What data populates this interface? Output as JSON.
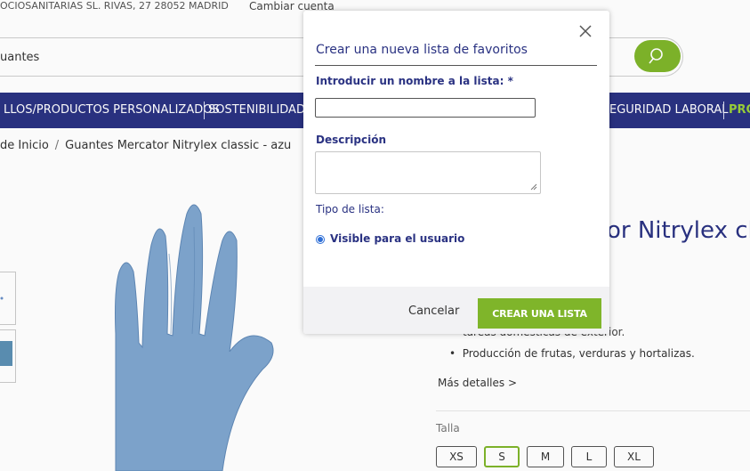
{
  "topbar": {
    "address": "OCIOSANITARIAS SL. RIVAS, 27 28052 MADRID",
    "account": "Cambiar cuenta"
  },
  "search": {
    "value": "uantes",
    "button_icon": "search-icon"
  },
  "nav": {
    "items": [
      "LLOS/PRODUCTOS PERSONALIZADOS",
      "SOSTENIBILIDAD",
      "EGURIDAD LABORAL",
      "PRO"
    ]
  },
  "breadcrumb": {
    "home": "de Inicio",
    "separator": "/",
    "current": "Guantes Mercator Nitrylex classic - azu"
  },
  "product": {
    "title": "or Nitrylex cla",
    "bullet_partial": "tareas domésticas de exterior.",
    "bullet": "Producción de frutas, verduras y hortalizas.",
    "more_details": "Más detalles >",
    "size_label": "Talla",
    "sizes": [
      "XS",
      "S",
      "M",
      "L",
      "XL"
    ],
    "selected_size": "S",
    "accent": "#7fb52a",
    "brand": "#2a3282"
  },
  "modal": {
    "title": "Crear una nueva lista de favoritos",
    "name_label": "Introducir un nombre a la lista: *",
    "name_value": "",
    "description_label": "Descripción",
    "description_value": "",
    "type_label": "Tipo de lista:",
    "radio_label": "Visible para el usuario",
    "radio_checked": true,
    "cancel_label": "Cancelar",
    "create_label": "CREAR UNA LISTA",
    "close_icon": "close-icon"
  }
}
